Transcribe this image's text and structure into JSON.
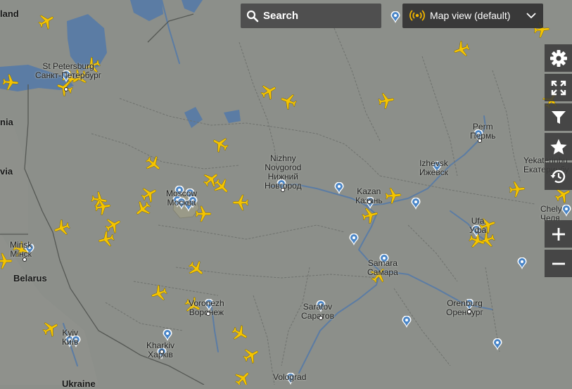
{
  "search": {
    "label": "Search",
    "icon": "search-icon"
  },
  "view_selector": {
    "label": "Map view (default)",
    "icon": "radar-icon",
    "accent": "#f0b400"
  },
  "toolbar": [
    {
      "name": "settings-button",
      "icon": "gear-icon"
    },
    {
      "name": "fullscreen-button",
      "icon": "fullscreen-icon"
    },
    {
      "name": "filter-button",
      "icon": "filter-icon"
    },
    {
      "name": "favorites-button",
      "icon": "star-icon"
    },
    {
      "name": "playback-button",
      "icon": "history-icon"
    },
    {
      "name": "zoom-in-button",
      "icon": "plus-icon"
    },
    {
      "name": "zoom-out-button",
      "icon": "minus-icon"
    }
  ],
  "map": {
    "colors": {
      "land": "#8c8f8a",
      "water": "#5b7ca4",
      "aircraft": "#f5c400",
      "airport_pin": "#4a86c8"
    },
    "countries": {
      "finland": "land",
      "latvia": "nia",
      "belarus": "Belarus",
      "lithuania": "via",
      "ukraine": "Ukraine"
    },
    "cities": {
      "st_petersburg": {
        "en": "St Petersburg",
        "ru": "Санкт-Петербург"
      },
      "nizhny": {
        "en1": "Nizhny",
        "en2": "Novgorod",
        "ru1": "Нижний",
        "ru2": "Новгород"
      },
      "moscow": {
        "en": "Moscow",
        "ru": "Москва"
      },
      "kazan": {
        "en": "Kazan",
        "ru": "Казань"
      },
      "perm": {
        "en": "Perm",
        "ru": "Пермь"
      },
      "izhevsk": {
        "en": "Izhevsk",
        "ru": "Ижевск"
      },
      "yekaterinburg": {
        "en": "Yekaterinbu",
        "ru": "Екатеринбу"
      },
      "ufa": {
        "en": "Ufa",
        "ru": "Уфа"
      },
      "chelyabinsk": {
        "en": "Chely",
        "ru": "Челя"
      },
      "minsk": {
        "en": "Minsk",
        "ru": "Мінск"
      },
      "samara": {
        "en": "Samara",
        "ru": "Самара"
      },
      "voronezh": {
        "en": "Voronezh",
        "ru": "Воронеж"
      },
      "saratov": {
        "en": "Saratov",
        "ru": "Саратов"
      },
      "orenburg": {
        "en": "Orenburg",
        "ru": "Оренбург"
      },
      "kyiv": {
        "en": "Kyiv",
        "ru": "Київ"
      },
      "kharkiv": {
        "en": "Kharkiv",
        "ru": "Харків"
      },
      "volgograd": {
        "en": "Volograd"
      }
    }
  }
}
